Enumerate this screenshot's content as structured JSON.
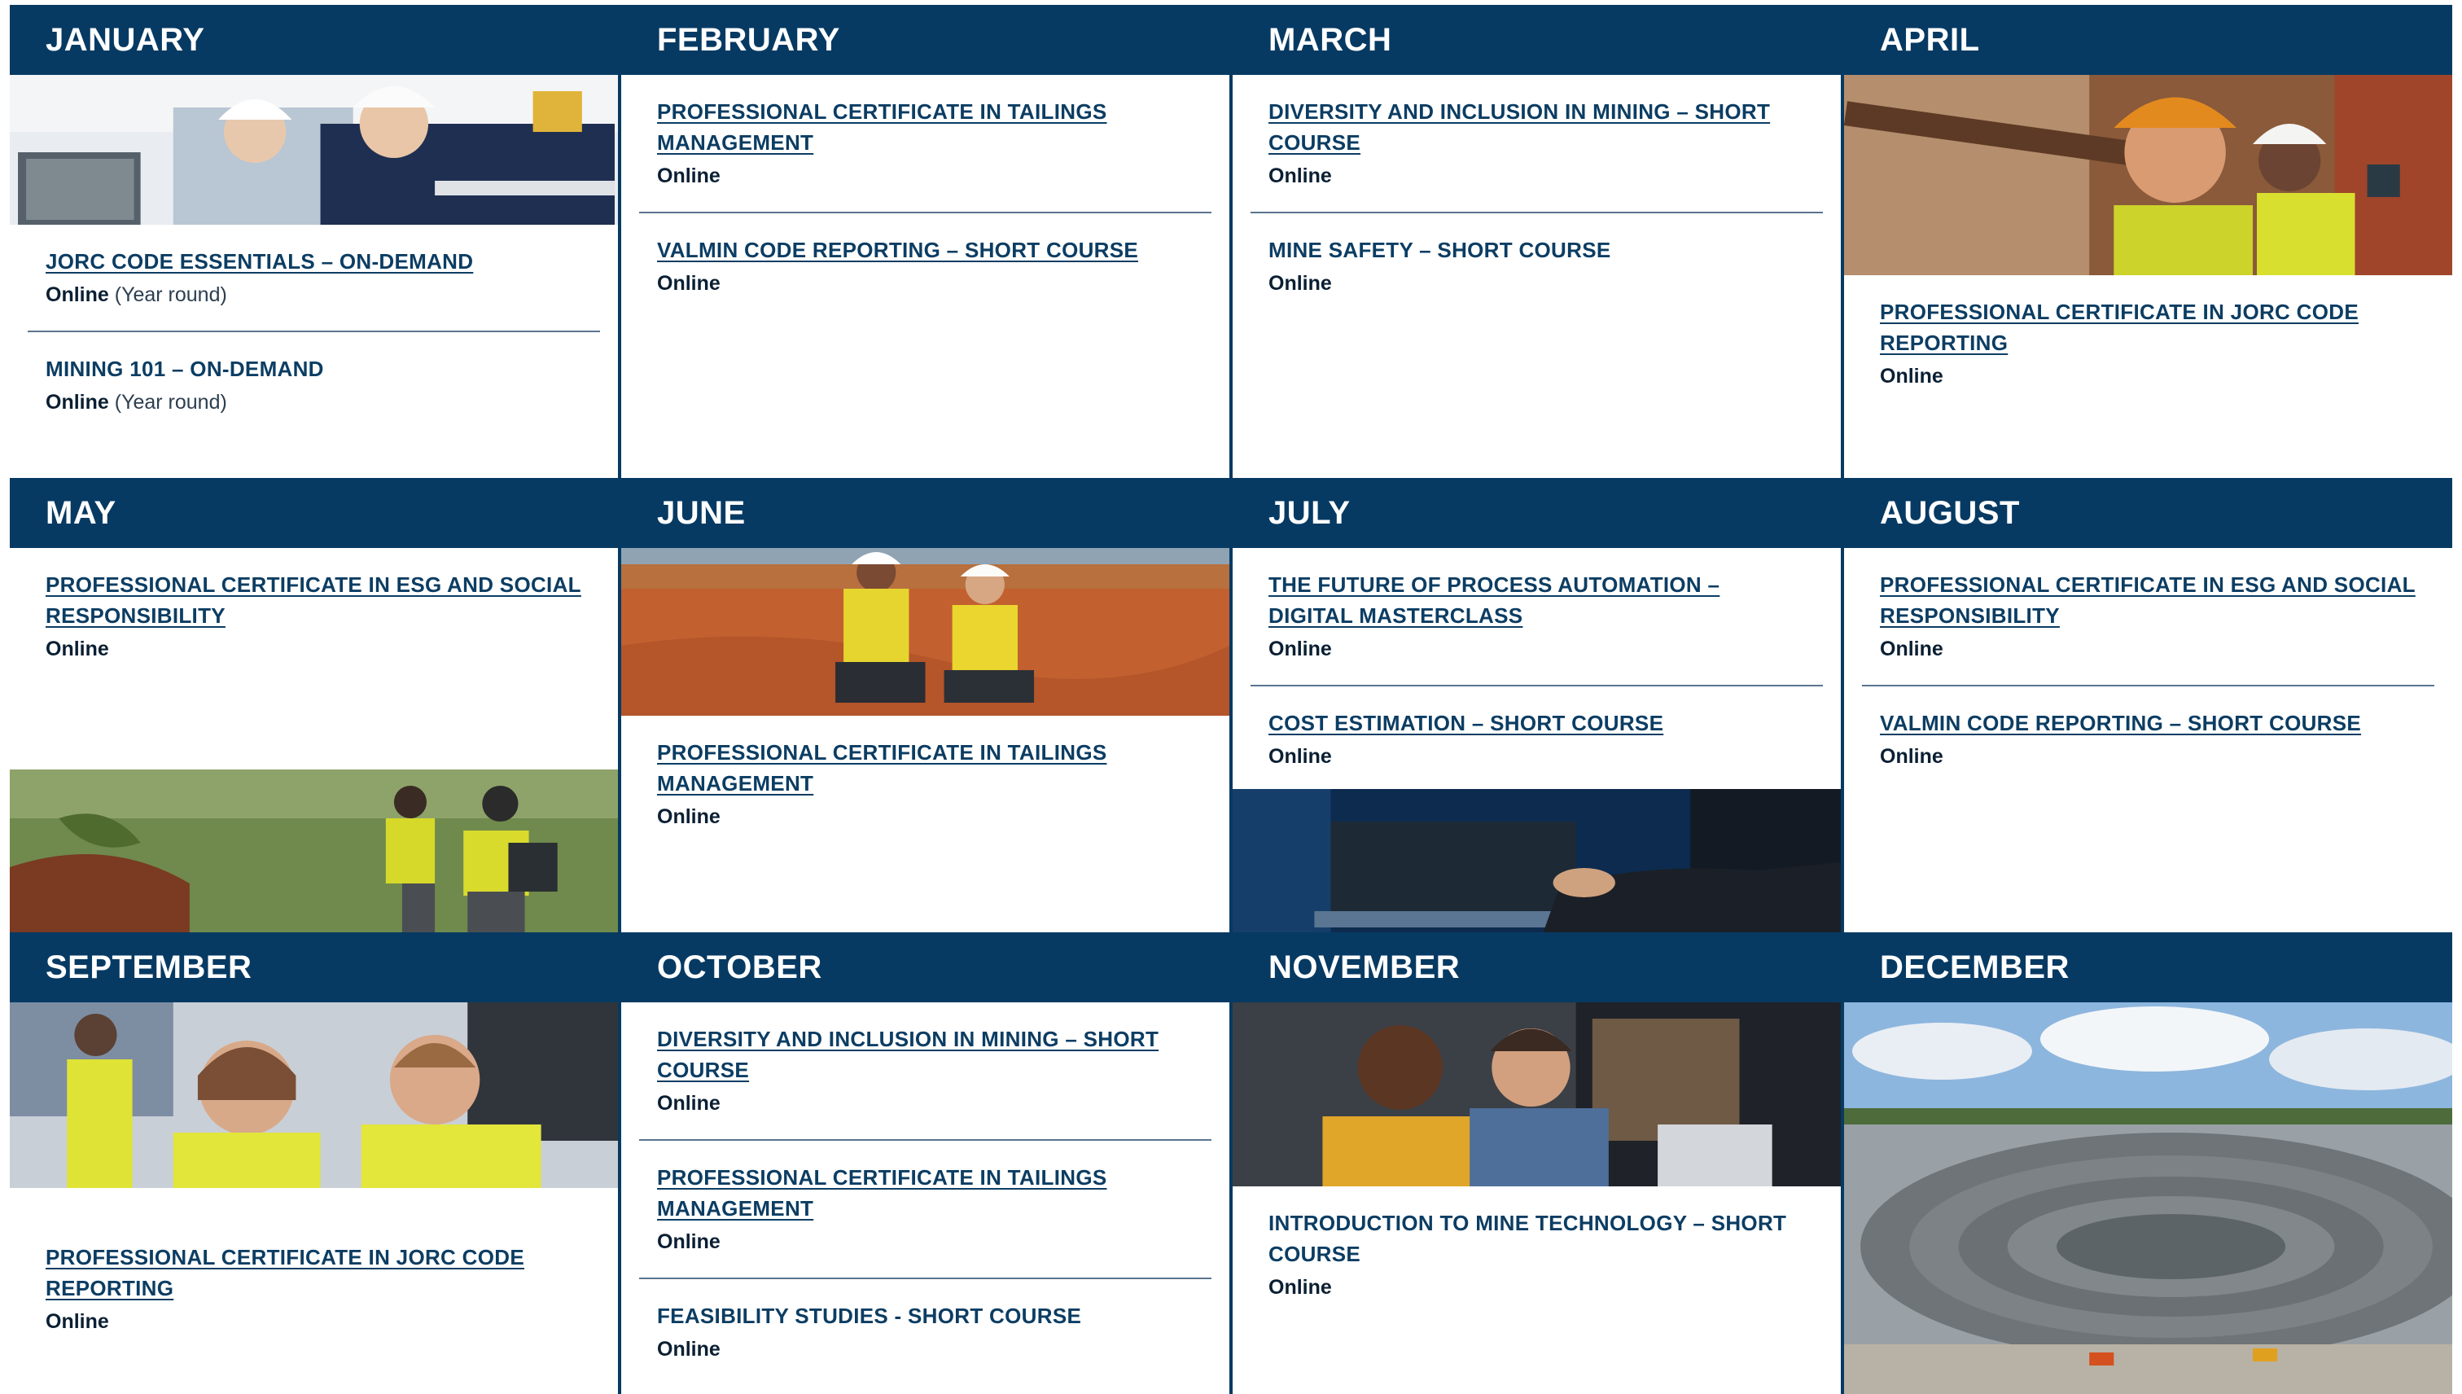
{
  "months": [
    {
      "name": "JANUARY",
      "courses": [
        {
          "title": "JORC CODE ESSENTIALS – ON-DEMAND",
          "mode": "Online",
          "period": "(Year round)",
          "link": true
        },
        {
          "title": "MINING 101 – ON-DEMAND",
          "mode": "Online",
          "period": "(Year round)",
          "link": false
        }
      ]
    },
    {
      "name": "FEBRUARY",
      "courses": [
        {
          "title": "PROFESSIONAL CERTIFICATE IN TAILINGS MANAGEMENT",
          "mode": "Online",
          "link": true
        },
        {
          "title": "VALMIN CODE REPORTING – SHORT COURSE",
          "mode": "Online",
          "link": true
        }
      ]
    },
    {
      "name": "MARCH",
      "courses": [
        {
          "title": "DIVERSITY AND INCLUSION IN MINING – SHORT COURSE",
          "mode": "Online",
          "link": true
        },
        {
          "title": "MINE SAFETY – SHORT COURSE",
          "mode": "Online",
          "link": false
        }
      ]
    },
    {
      "name": "APRIL",
      "courses": [
        {
          "title": "PROFESSIONAL CERTIFICATE IN JORC CODE REPORTING",
          "mode": "Online",
          "link": true
        }
      ]
    },
    {
      "name": "MAY",
      "courses": [
        {
          "title": "PROFESSIONAL CERTIFICATE IN ESG AND SOCIAL RESPONSIBILITY",
          "mode": "Online",
          "link": true
        }
      ]
    },
    {
      "name": "JUNE",
      "courses": [
        {
          "title": "PROFESSIONAL CERTIFICATE IN TAILINGS MANAGEMENT",
          "mode": "Online",
          "link": true
        }
      ]
    },
    {
      "name": "JULY",
      "courses": [
        {
          "title": "THE FUTURE OF PROCESS AUTOMATION – DIGITAL MASTERCLASS",
          "mode": "Online",
          "link": true
        },
        {
          "title": "COST ESTIMATION – SHORT COURSE",
          "mode": "Online",
          "link": true
        }
      ]
    },
    {
      "name": "AUGUST",
      "courses": [
        {
          "title": "PROFESSIONAL CERTIFICATE IN ESG AND SOCIAL RESPONSIBILITY",
          "mode": "Online",
          "link": true
        },
        {
          "title": "VALMIN CODE REPORTING – SHORT COURSE",
          "mode": "Online",
          "link": true
        }
      ]
    },
    {
      "name": "SEPTEMBER",
      "courses": [
        {
          "title": "PROFESSIONAL CERTIFICATE IN JORC CODE REPORTING",
          "mode": "Online",
          "link": true
        }
      ]
    },
    {
      "name": "OCTOBER",
      "courses": [
        {
          "title": "DIVERSITY AND INCLUSION IN MINING – SHORT COURSE",
          "mode": "Online",
          "link": true
        },
        {
          "title": "PROFESSIONAL CERTIFICATE IN TAILINGS MANAGEMENT",
          "mode": "Online",
          "link": true
        },
        {
          "title": "FEASIBILITY STUDIES - SHORT COURSE",
          "mode": "Online",
          "link": false
        }
      ]
    },
    {
      "name": "NOVEMBER",
      "courses": [
        {
          "title": "INTRODUCTION TO MINE TECHNOLOGY – SHORT COURSE",
          "mode": "Online",
          "link": false
        }
      ]
    },
    {
      "name": "DECEMBER",
      "courses": []
    }
  ],
  "colors": {
    "header_bg": "#063a63",
    "link": "#0c3d63",
    "divider": "#5a7590"
  }
}
